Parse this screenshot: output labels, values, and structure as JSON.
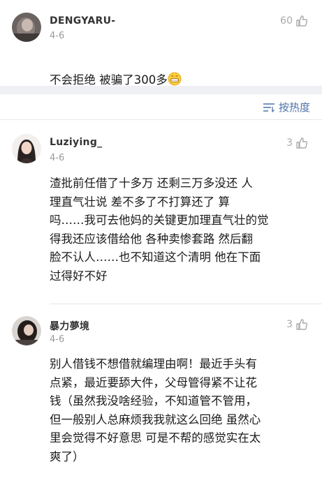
{
  "comments": [
    {
      "username": "DENGYARU-",
      "date": "4-6",
      "likes": "60",
      "text": "不会拒绝 被骗了300多",
      "emoji": "grinning-face-emoji"
    },
    {
      "username": "Luziying_",
      "date": "4-6",
      "likes": "3",
      "text": "渣批前任借了十多万   还剩三万多没还  人\n理直气壮说  差不多了不打算还了    算\n吗……我可去他妈的关键更加理直气壮的觉\n得我还应该借给他    各种卖惨套路    然后翻\n脸不认人……也不知道这个清明  他在下面\n过得好不好"
    },
    {
      "username": "暴力夢境",
      "date": "4-6",
      "likes": "3",
      "text": "别人借钱不想借就编理由啊！最近手头有\n点紧，最近要舔大件，父母管得紧不让花\n钱（虽然我没啥经验，不知道管不管用，\n但一般别人总麻烦我我就这么回绝 虽然心\n里会觉得不好意思 可是不帮的感觉实在太\n爽了）"
    }
  ],
  "sort": {
    "label": "按热度",
    "icon": "sort-icon"
  },
  "colors": {
    "link_blue": "#4e73a8",
    "muted_gray": "#999999",
    "band_gray": "#eef0f3"
  }
}
